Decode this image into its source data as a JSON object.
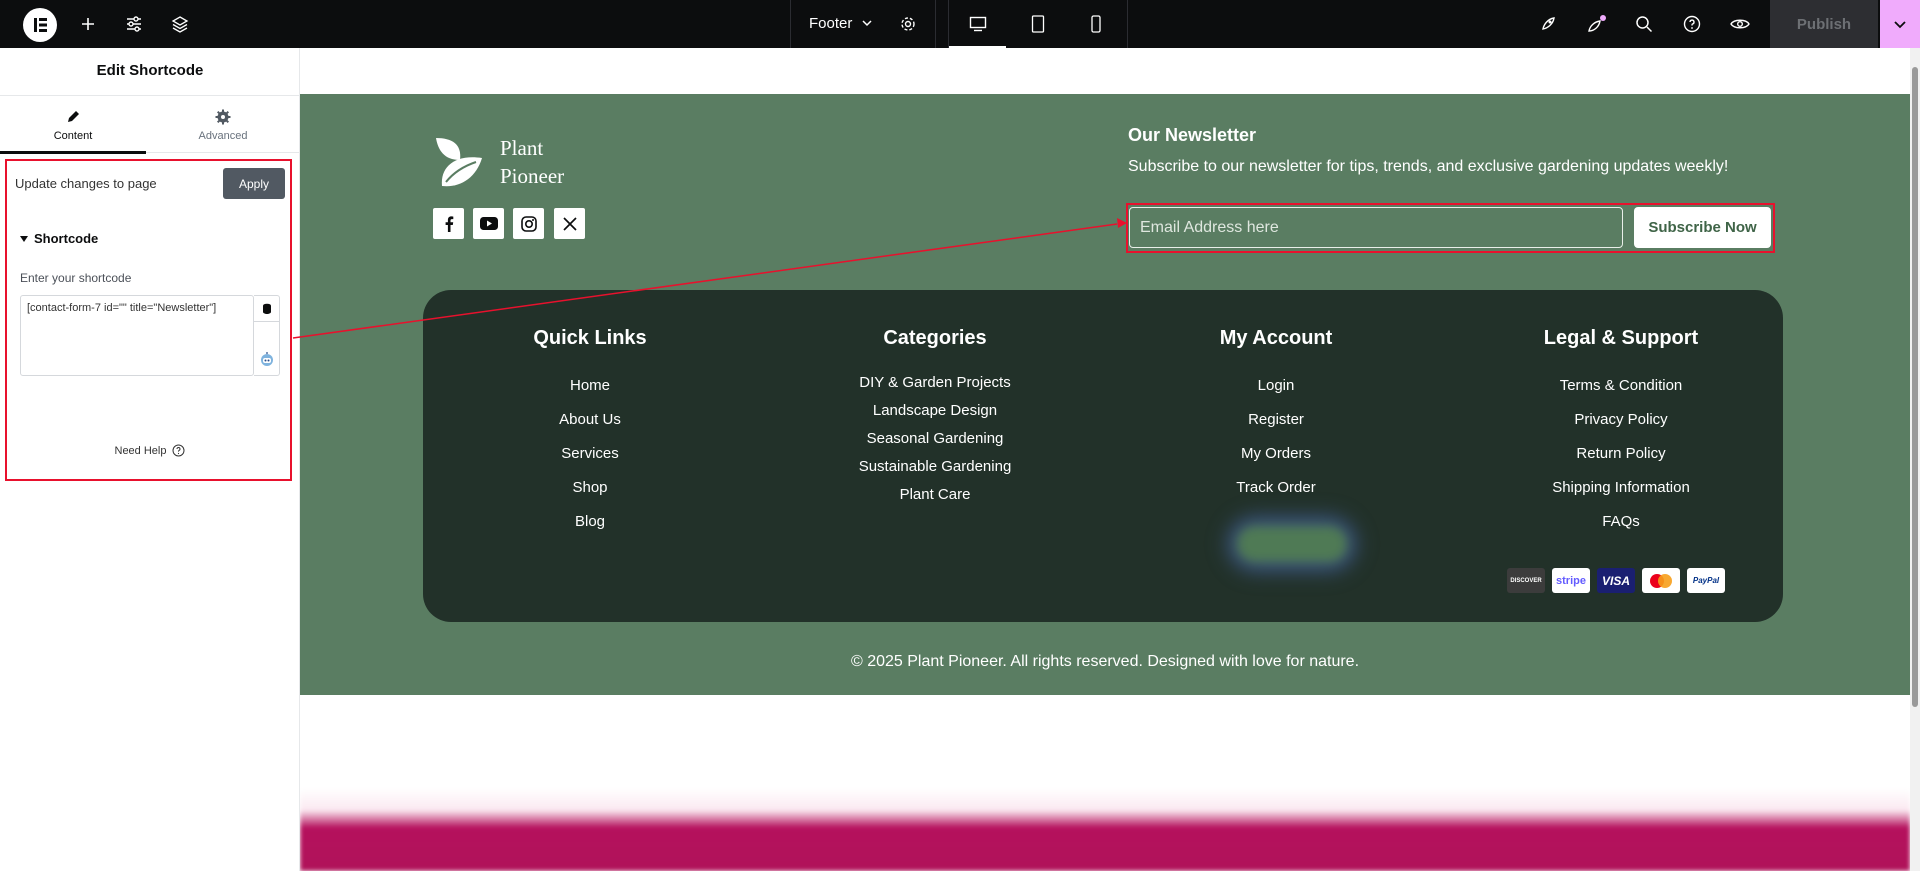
{
  "topbar": {
    "doc_name": "Footer",
    "publish_label": "Publish",
    "colors": {
      "bg": "#0c0d0e",
      "accent": "#f0abfc",
      "notification": "#f0abfc"
    }
  },
  "panel": {
    "title": "Edit Shortcode",
    "tabs": [
      {
        "label": "Content",
        "icon": "pencil-icon"
      },
      {
        "label": "Advanced",
        "icon": "gear-icon"
      }
    ],
    "update_label": "Update changes to page",
    "apply_label": "Apply",
    "section_title": "Shortcode",
    "field_label": "Enter your shortcode",
    "shortcode_value": "[contact-form-7 id=\"\" title=\"Newsletter\"]",
    "help_label": "Need Help"
  },
  "footer": {
    "brand": {
      "line1": "Plant",
      "line2": "Pioneer"
    },
    "socials": [
      "facebook-icon",
      "youtube-icon",
      "instagram-icon",
      "x-icon"
    ],
    "newsletter": {
      "title": "Our Newsletter",
      "description": "Subscribe to our newsletter for tips, trends, and exclusive gardening updates weekly!",
      "email_placeholder": "Email Address here",
      "subscribe_label": "Subscribe Now"
    },
    "columns": [
      {
        "title": "Quick Links",
        "links": [
          "Home",
          "About Us",
          "Services",
          "Shop",
          "Blog"
        ]
      },
      {
        "title": "Categories",
        "links": [
          "DIY & Garden Projects",
          "Landscape Design",
          "Seasonal Gardening",
          "Sustainable Gardening",
          "Plant Care"
        ]
      },
      {
        "title": "My Account",
        "links": [
          "Login",
          "Register",
          "My Orders",
          "Track Order"
        ]
      },
      {
        "title": "Legal & Support",
        "links": [
          "Terms & Condition",
          "Privacy Policy",
          "Return Policy",
          "Shipping Information",
          "FAQs"
        ]
      }
    ],
    "payments": [
      "DISCOVER",
      "stripe",
      "VISA",
      "mastercard",
      "PayPal"
    ],
    "copyright": "© 2025 Plant Pioneer. All rights reserved. Designed with love for nature.",
    "colors": {
      "bg": "#5a7d62",
      "inner": "#223129",
      "highlight": "#e8112d"
    }
  }
}
